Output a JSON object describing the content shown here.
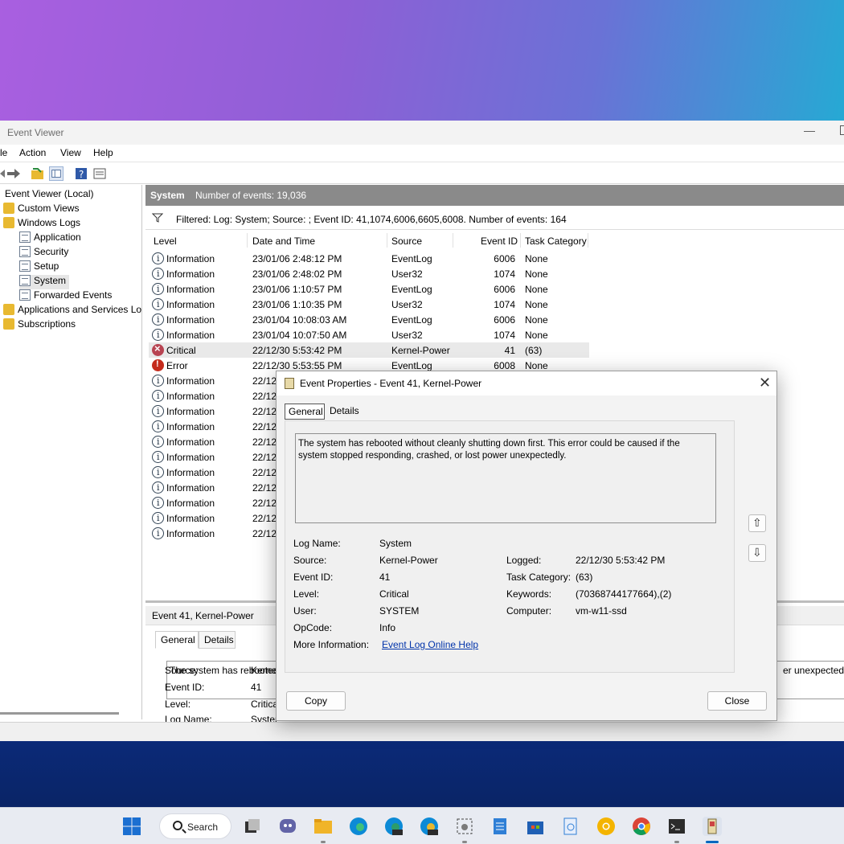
{
  "window": {
    "title": "Event Viewer"
  },
  "menu": [
    "le",
    "Action",
    "View",
    "Help"
  ],
  "tree": [
    {
      "label": "Event Viewer (Local)"
    },
    {
      "label": "Custom Views"
    },
    {
      "label": "Windows Logs"
    },
    {
      "label": "Application"
    },
    {
      "label": "Security"
    },
    {
      "label": "Setup"
    },
    {
      "label": "System"
    },
    {
      "label": "Forwarded Events"
    },
    {
      "label": "Applications and Services Lo"
    },
    {
      "label": "Subscriptions"
    }
  ],
  "pane": {
    "name": "System",
    "count": "Number of events: 19,036",
    "filter": "Filtered: Log: System; Source: ; Event ID: 41,1074,6006,6605,6008. Number of events: 164"
  },
  "columns": [
    "Level",
    "Date and Time",
    "Source",
    "Event ID",
    "Task Category"
  ],
  "rows": [
    {
      "level": "Information",
      "date": "23/01/06 2:48:12 PM",
      "source": "EventLog",
      "id": "6006",
      "cat": "None",
      "icon": "info-icon"
    },
    {
      "level": "Information",
      "date": "23/01/06 2:48:02 PM",
      "source": "User32",
      "id": "1074",
      "cat": "None",
      "icon": "info-icon"
    },
    {
      "level": "Information",
      "date": "23/01/06 1:10:57 PM",
      "source": "EventLog",
      "id": "6006",
      "cat": "None",
      "icon": "info-icon"
    },
    {
      "level": "Information",
      "date": "23/01/06 1:10:35 PM",
      "source": "User32",
      "id": "1074",
      "cat": "None",
      "icon": "info-icon"
    },
    {
      "level": "Information",
      "date": "23/01/04 10:08:03 AM",
      "source": "EventLog",
      "id": "6006",
      "cat": "None",
      "icon": "info-icon"
    },
    {
      "level": "Information",
      "date": "23/01/04 10:07:50 AM",
      "source": "User32",
      "id": "1074",
      "cat": "None",
      "icon": "info-icon"
    },
    {
      "level": "Critical",
      "date": "22/12/30 5:53:42 PM",
      "source": "Kernel-Power",
      "id": "41",
      "cat": "(63)",
      "icon": "critical-icon"
    },
    {
      "level": "Error",
      "date": "22/12/30 5:53:55 PM",
      "source": "EventLog",
      "id": "6008",
      "cat": "None",
      "icon": "error-icon"
    },
    {
      "level": "Information",
      "date": "22/12",
      "source": "",
      "id": "",
      "cat": "",
      "icon": "info-icon"
    },
    {
      "level": "Information",
      "date": "22/12",
      "source": "",
      "id": "",
      "cat": "",
      "icon": "info-icon"
    },
    {
      "level": "Information",
      "date": "22/12",
      "source": "",
      "id": "",
      "cat": "",
      "icon": "info-icon"
    },
    {
      "level": "Information",
      "date": "22/12",
      "source": "",
      "id": "",
      "cat": "",
      "icon": "info-icon"
    },
    {
      "level": "Information",
      "date": "22/12",
      "source": "",
      "id": "",
      "cat": "",
      "icon": "info-icon"
    },
    {
      "level": "Information",
      "date": "22/12",
      "source": "",
      "id": "",
      "cat": "",
      "icon": "info-icon"
    },
    {
      "level": "Information",
      "date": "22/12",
      "source": "",
      "id": "",
      "cat": "",
      "icon": "info-icon"
    },
    {
      "level": "Information",
      "date": "22/12",
      "source": "",
      "id": "",
      "cat": "",
      "icon": "info-icon"
    },
    {
      "level": "Information",
      "date": "22/12",
      "source": "",
      "id": "",
      "cat": "",
      "icon": "info-icon"
    },
    {
      "level": "Information",
      "date": "22/12",
      "source": "",
      "id": "",
      "cat": "",
      "icon": "info-icon"
    },
    {
      "level": "Information",
      "date": "22/12",
      "source": "",
      "id": "",
      "cat": "",
      "icon": "info-icon"
    }
  ],
  "detail": {
    "title": "Event 41, Kernel-Power",
    "tab_general": "General",
    "tab_details": "Details",
    "msg_start": "The system has rebooted",
    "msg_end": "er unexpectedly.",
    "fields": [
      {
        "label": "Log Name:",
        "value": "Syster"
      },
      {
        "label": "Source:",
        "value": "Kerne"
      },
      {
        "label": "Event ID:",
        "value": "41"
      },
      {
        "label": "Level:",
        "value": "Critica"
      }
    ]
  },
  "dialog": {
    "title": "Event Properties - Event 41, Kernel-Power",
    "tab_general": "General",
    "tab_details": "Details",
    "message": "The system has rebooted without cleanly shutting down first. This error could be caused if the system stopped responding, crashed, or lost power unexpectedly.",
    "log_name_label": "Log Name:",
    "log_name": "System",
    "source_label": "Source:",
    "source": "Kernel-Power",
    "logged_label": "Logged:",
    "logged": "22/12/30 5:53:42 PM",
    "event_id_label": "Event ID:",
    "event_id": "41",
    "task_cat_label": "Task Category:",
    "task_cat": "(63)",
    "level_label": "Level:",
    "level": "Critical",
    "keywords_label": "Keywords:",
    "keywords": "(70368744177664),(2)",
    "user_label": "User:",
    "user": "SYSTEM",
    "computer_label": "Computer:",
    "computer": "vm-w11-ssd",
    "opcode_label": "OpCode:",
    "opcode": "Info",
    "more_info_label": "More Information:",
    "more_info_link": "Event Log Online Help",
    "copy": "Copy",
    "close": "Close"
  },
  "taskbar": {
    "search": "Search"
  },
  "colors": {
    "pane_header": "#8a8a8a",
    "link": "#0033aa",
    "accent": "#0067c0"
  }
}
